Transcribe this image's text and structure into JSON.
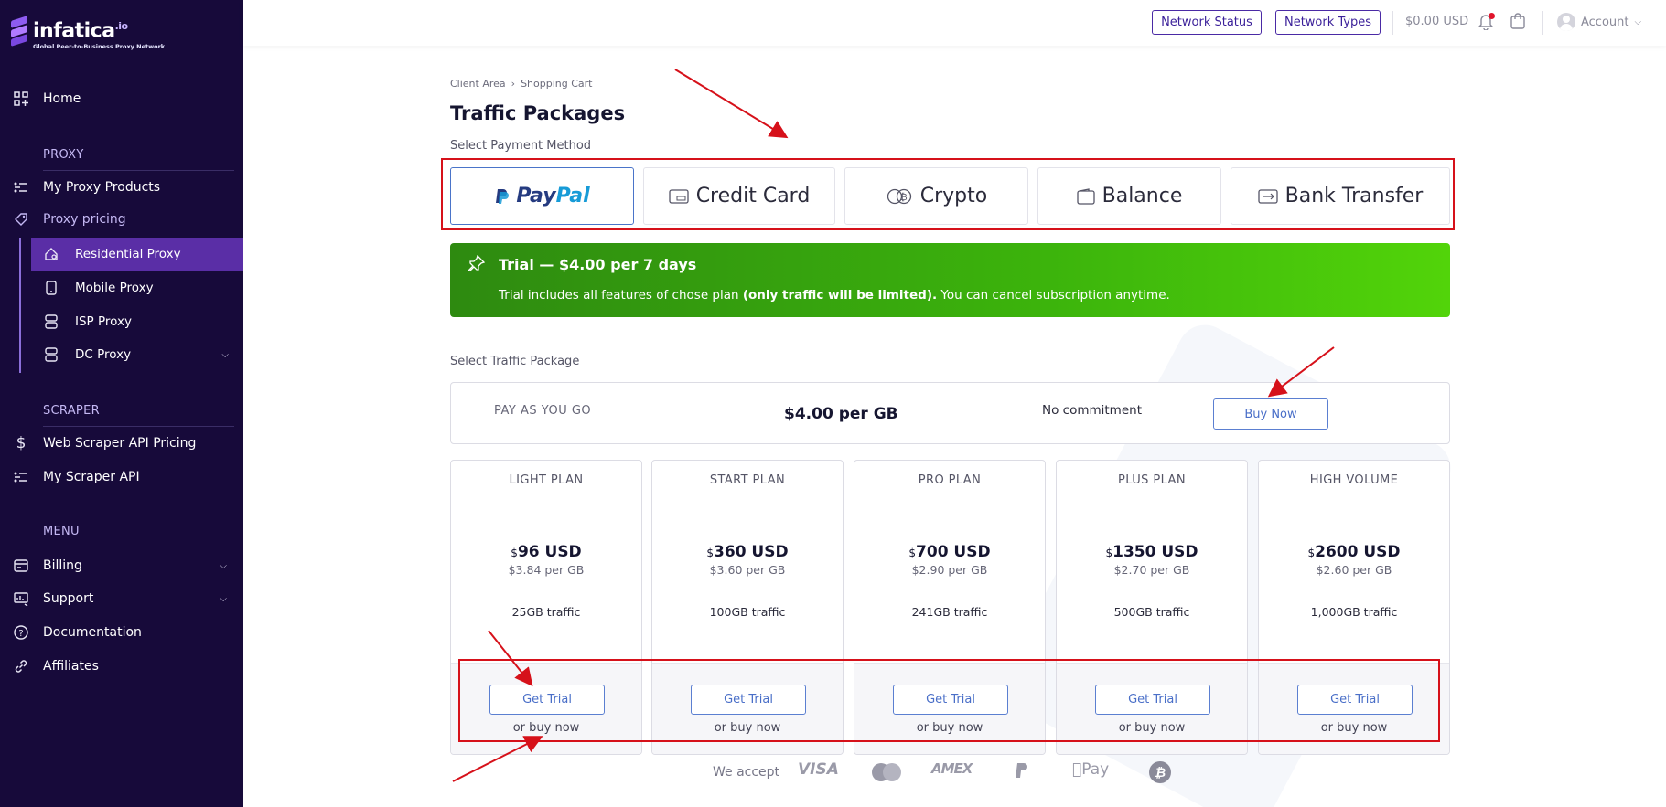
{
  "sidebar": {
    "brand": "infatica",
    "brand_suffix": ".io",
    "tagline": "Global Peer-to-Business Proxy Network",
    "home": "Home",
    "proxy_section": "PROXY",
    "my_proxy_products": "My Proxy Products",
    "proxy_pricing": "Proxy pricing",
    "residential": "Residential Proxy",
    "mobile": "Mobile Proxy",
    "isp": "ISP Proxy",
    "dc": "DC Proxy",
    "scraper_section": "SCRAPER",
    "web_scraper_pricing": "Web Scraper API Pricing",
    "my_scraper": "My Scraper API",
    "menu_section": "MENU",
    "billing": "Billing",
    "support": "Support",
    "documentation": "Documentation",
    "affiliates": "Affiliates"
  },
  "topbar": {
    "network_status": "Network Status",
    "network_types": "Network Types",
    "balance": "$0.00 USD",
    "account": "Account"
  },
  "breadcrumb": {
    "root": "Client Area",
    "current": "Shopping Cart"
  },
  "page_title": "Traffic Packages",
  "payment": {
    "label": "Select Payment Method",
    "paypal_a": "Pay",
    "paypal_b": "Pal",
    "credit_card": "Credit Card",
    "crypto": "Crypto",
    "balance": "Balance",
    "bank_transfer": "Bank Transfer"
  },
  "trial": {
    "title": "Trial — $4.00 per 7 days",
    "text_a": "Trial includes all features of chose plan ",
    "text_b": "(only traffic will be limited).",
    "text_c": " You can cancel subscription anytime."
  },
  "traffic_label": "Select Traffic Package",
  "payg": {
    "name": "PAY AS YOU GO",
    "price": "$4.00 per GB",
    "commitment": "No commitment",
    "buy": "Buy Now"
  },
  "plans": [
    {
      "name": "LIGHT PLAN",
      "currency": "$",
      "price": "96 USD",
      "per_gb": "$3.84 per GB",
      "traffic": "25GB traffic",
      "trial": "Get Trial",
      "or_buy": "or buy now"
    },
    {
      "name": "START PLAN",
      "currency": "$",
      "price": "360 USD",
      "per_gb": "$3.60 per GB",
      "traffic": "100GB traffic",
      "trial": "Get Trial",
      "or_buy": "or buy now"
    },
    {
      "name": "PRO PLAN",
      "currency": "$",
      "price": "700 USD",
      "per_gb": "$2.90 per GB",
      "traffic": "241GB traffic",
      "trial": "Get Trial",
      "or_buy": "or buy now"
    },
    {
      "name": "PLUS PLAN",
      "currency": "$",
      "price": "1350 USD",
      "per_gb": "$2.70 per GB",
      "traffic": "500GB traffic",
      "trial": "Get Trial",
      "or_buy": "or buy now"
    },
    {
      "name": "HIGH VOLUME",
      "currency": "$",
      "price": "2600 USD",
      "per_gb": "$2.60 per GB",
      "traffic": "1,000GB traffic",
      "trial": "Get Trial",
      "or_buy": "or buy now"
    }
  ],
  "footer": {
    "we_accept": "We accept",
    "visa": "VISA",
    "amex": "AMEX",
    "apple_pay": "Pay"
  },
  "colors": {
    "sidebar_bg": "#170a3a",
    "active_item": "#5a2ea6",
    "accent_blue": "#4a6fc8",
    "trial_green": "#3cb40c",
    "annotation_red": "#d6111a"
  }
}
